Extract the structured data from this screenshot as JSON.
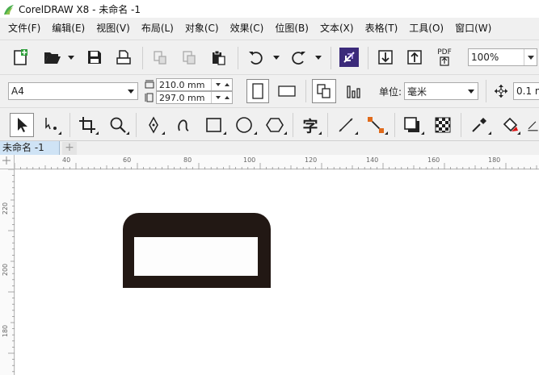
{
  "window": {
    "title": "CorelDRAW X8 - 未命名 -1"
  },
  "menu": [
    "文件(F)",
    "编辑(E)",
    "视图(V)",
    "布局(L)",
    "对象(C)",
    "效果(C)",
    "位图(B)",
    "文本(X)",
    "表格(T)",
    "工具(O)",
    "窗口(W)"
  ],
  "toolbar": {
    "zoom": "100%",
    "icons": [
      "new-document-icon",
      "open-folder-icon",
      "save-icon",
      "print-icon",
      "copy-format-icon",
      "paste-format-icon",
      "clipboard-icon",
      "undo-icon",
      "redo-icon",
      "snap-icon",
      "import-icon",
      "export-icon",
      "pdf-icon"
    ],
    "pdf_label": "PDF"
  },
  "property_bar": {
    "paper_size": "A4",
    "width": "210.0 mm",
    "height": "297.0 mm",
    "units_label": "单位:",
    "units": "毫米",
    "nudge": "0.1 m"
  },
  "toolbox": [
    "pick-tool",
    "shape-tool",
    "crop-tool",
    "zoom-tool",
    "pen-tool",
    "freehand-tool",
    "rectangle-tool",
    "ellipse-tool",
    "polygon-tool",
    "text-tool",
    "dimension-tool",
    "connector-tool",
    "drop-shadow-tool",
    "transparency-tool",
    "eyedropper-tool",
    "fill-tool"
  ],
  "toolbox_text_glyph": "字",
  "document_tab": {
    "label": "未命名 -1",
    "add": "+"
  },
  "ruler": {
    "h_labels": [
      "40",
      "60",
      "80",
      "100",
      "120",
      "140",
      "160",
      "180"
    ],
    "v_labels": [
      "220",
      "200",
      "180"
    ]
  },
  "colors": {
    "shape": "#221814",
    "tab_active": "#cfe3f5"
  }
}
